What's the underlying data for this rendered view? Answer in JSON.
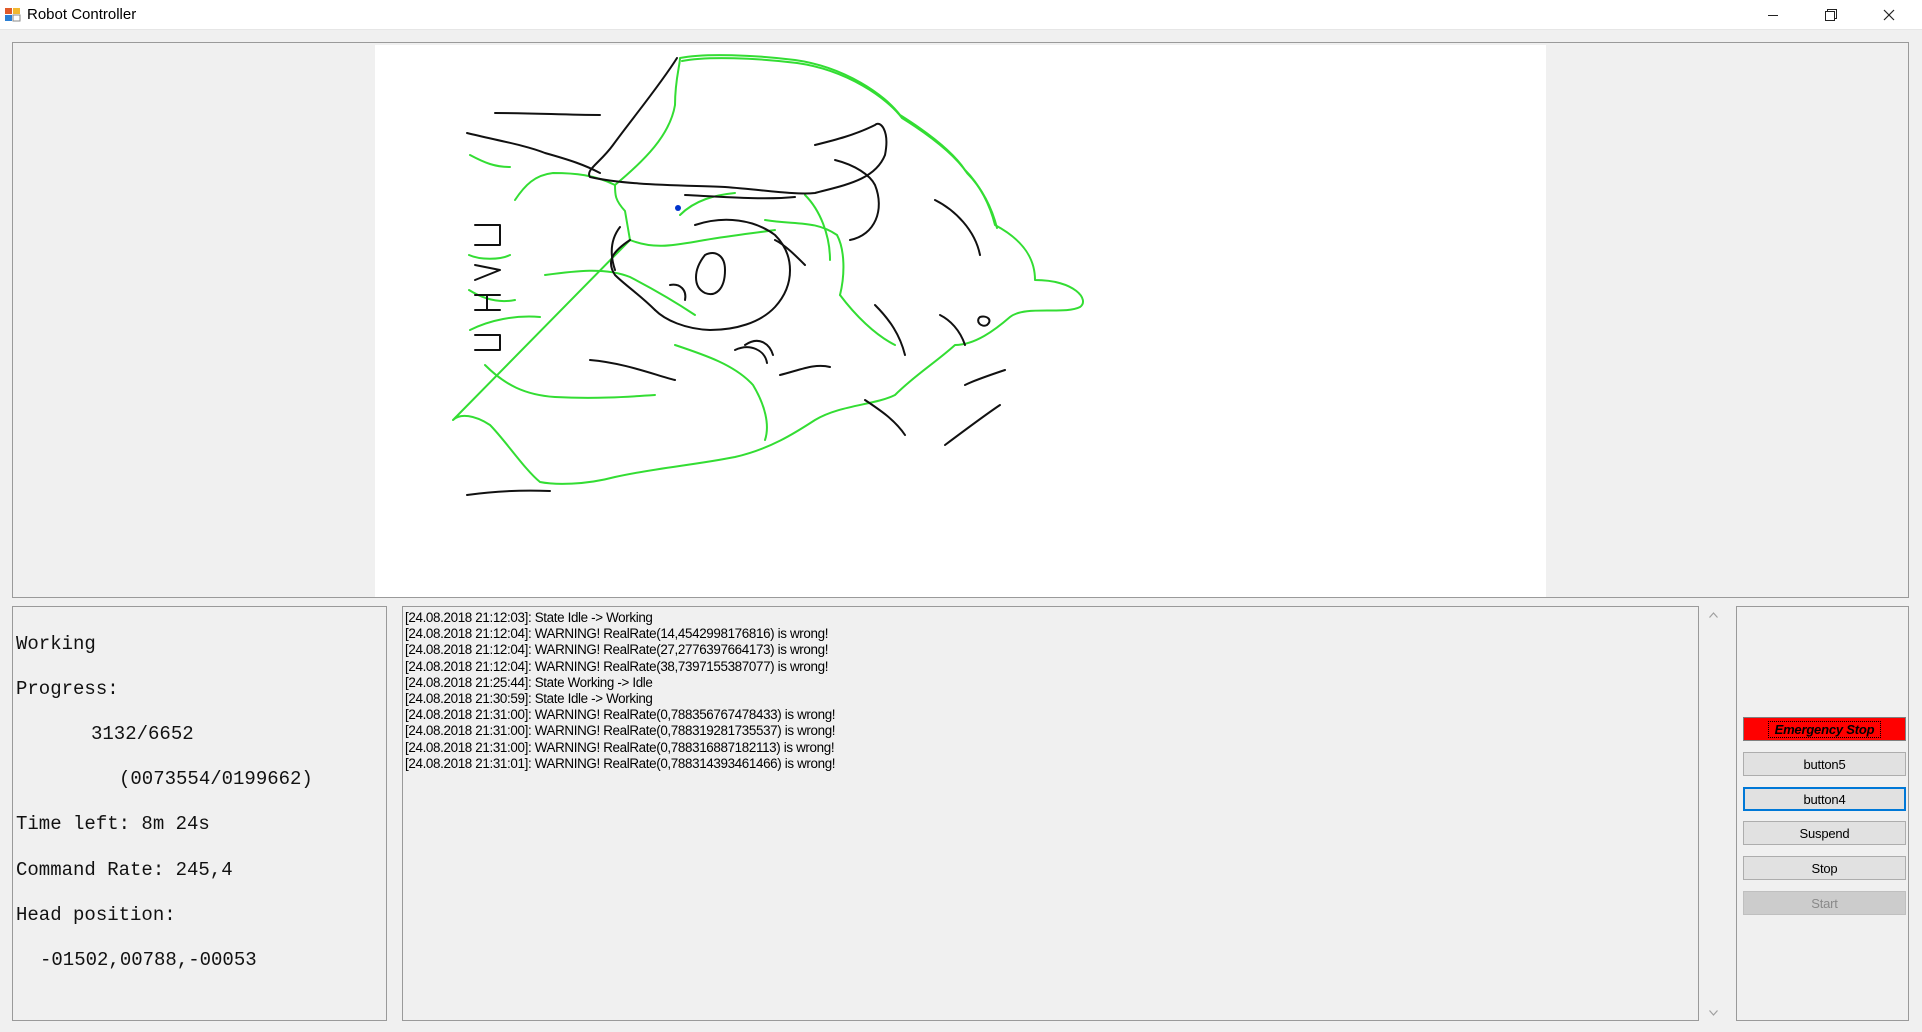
{
  "window": {
    "title": "Robot Controller",
    "icon": "app-icon"
  },
  "status": {
    "state": "Working",
    "progress_label": "Progress:",
    "progress_count": "3132/6652",
    "progress_detail": "(0073554/0199662)",
    "time_left": "Time left: 8m 24s",
    "command_rate": "Command Rate: 245,4",
    "head_position_label": "Head position:",
    "head_position": "-01502,00788,-00053"
  },
  "log": [
    "[24.08.2018 21:12:03]: State Idle -> Working",
    "[24.08.2018 21:12:04]: WARNING! RealRate(14,4542998176816) is wrong!",
    "[24.08.2018 21:12:04]: WARNING! RealRate(27,2776397664173) is wrong!",
    "[24.08.2018 21:12:04]: WARNING! RealRate(38,7397155387077) is wrong!",
    "[24.08.2018 21:25:44]: State Working -> Idle",
    "[24.08.2018 21:30:59]: State Idle -> Working",
    "[24.08.2018 21:31:00]: WARNING! RealRate(0,788356767478433) is wrong!",
    "[24.08.2018 21:31:00]: WARNING! RealRate(0,788319281735537) is wrong!",
    "[24.08.2018 21:31:00]: WARNING! RealRate(0,788316887182113) is wrong!",
    "[24.08.2018 21:31:01]: WARNING! RealRate(0,788314393461466) is wrong!"
  ],
  "buttons": {
    "emergency_stop": "Emergency Stop",
    "button5": "button5",
    "button4": "button4",
    "suspend": "Suspend",
    "stop": "Stop",
    "start": "Start"
  },
  "colors": {
    "emergency": "#ff0000",
    "drawn_path": "#33dd33",
    "pending_path": "#111111",
    "head_marker": "#0033cc",
    "focus": "#0078d7"
  }
}
